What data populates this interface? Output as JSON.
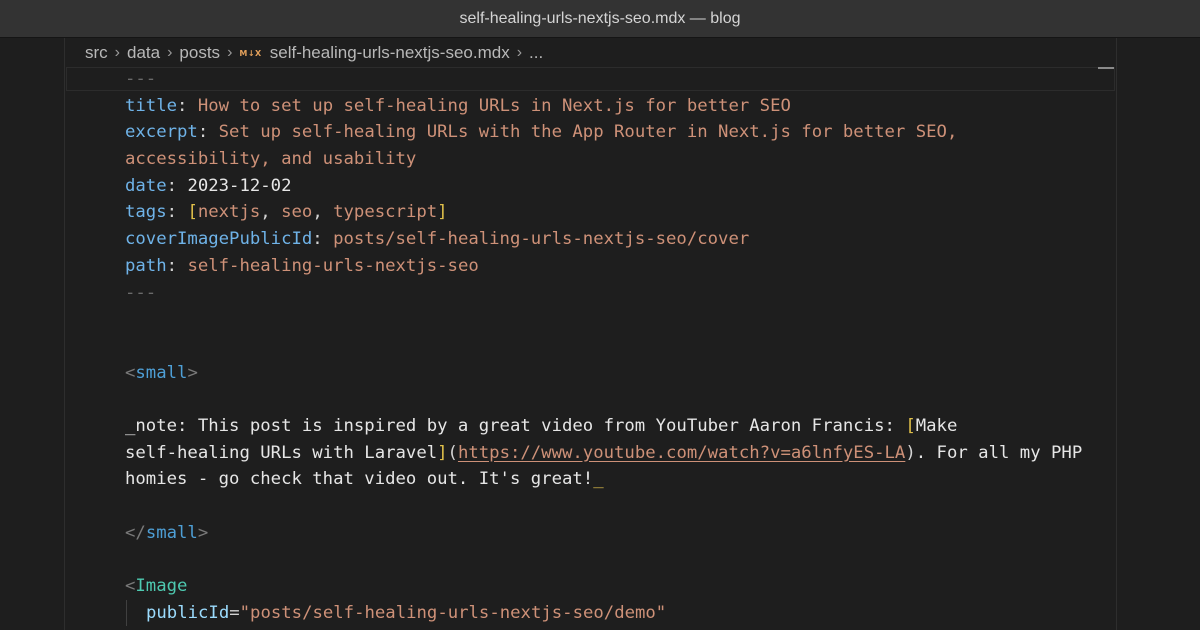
{
  "window": {
    "title": "self-healing-urls-nextjs-seo.mdx — blog"
  },
  "breadcrumb": {
    "segments": [
      "src",
      "data",
      "posts"
    ],
    "file_icon": "M↓X",
    "file_name": "self-healing-urls-nextjs-seo.mdx",
    "more": "..."
  },
  "frontmatter": {
    "fence": "---",
    "title_key": "title",
    "title_value": "How to set up self-healing URLs in Next.js for better SEO",
    "excerpt_key": "excerpt",
    "excerpt_value_line1": "Set up self-healing URLs with the App Router in Next.js for better SEO,",
    "excerpt_value_line2": "accessibility, and usability",
    "date_key": "date",
    "date_value": "2023-12-02",
    "tags_key": "tags",
    "tags": [
      "nextjs",
      "seo",
      "typescript"
    ],
    "cover_key": "coverImagePublicId",
    "cover_value": "posts/self-healing-urls-nextjs-seo/cover",
    "path_key": "path",
    "path_value": "self-healing-urls-nextjs-seo"
  },
  "body": {
    "small_tag": "small",
    "note_line1": "_note: This post is inspired by a great video from YouTuber Aaron Francis: ",
    "link_text_part1": "Make",
    "link_text_part2": "self-healing URLs with Laravel",
    "link_url": "https://www.youtube.com/watch?v=a6lnfyES-LA",
    "note_after_link": ". For all my PHP",
    "note_line3": "homies - go check that video out. It's great!",
    "note_end": "_",
    "image_component": "Image",
    "image_attr": "publicId",
    "image_value": "\"posts/self-healing-urls-nextjs-seo/demo\""
  }
}
